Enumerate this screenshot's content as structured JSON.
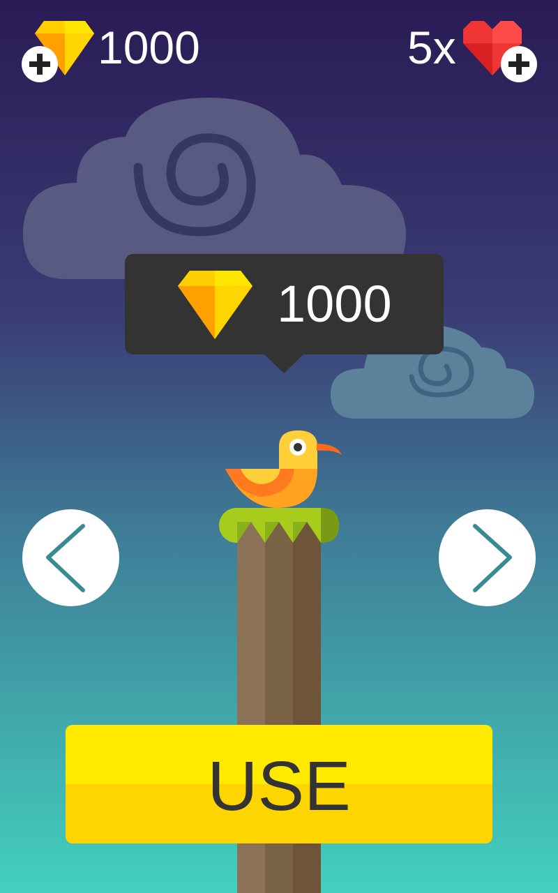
{
  "hud": {
    "gems": {
      "count": "1000",
      "icon": "yellow-diamond-icon",
      "add_icon": "plus-icon"
    },
    "lives": {
      "count": "5x",
      "icon": "red-heart-icon",
      "add_icon": "plus-icon"
    }
  },
  "character_preview": {
    "price": "1000",
    "price_icon": "yellow-diamond-icon",
    "character": "orange-bird",
    "prev_icon": "chevron-left-icon",
    "next_icon": "chevron-right-icon"
  },
  "actions": {
    "use_label": "USE"
  },
  "colors": {
    "sky_top": "#2a1b55",
    "sky_bottom": "#43d0be",
    "gem_yellow": "#ffd700",
    "heart_red": "#f03535",
    "button_yellow": "#ffea00",
    "tooltip_bg": "#333333",
    "arrow_teal": "#3a8a95"
  }
}
